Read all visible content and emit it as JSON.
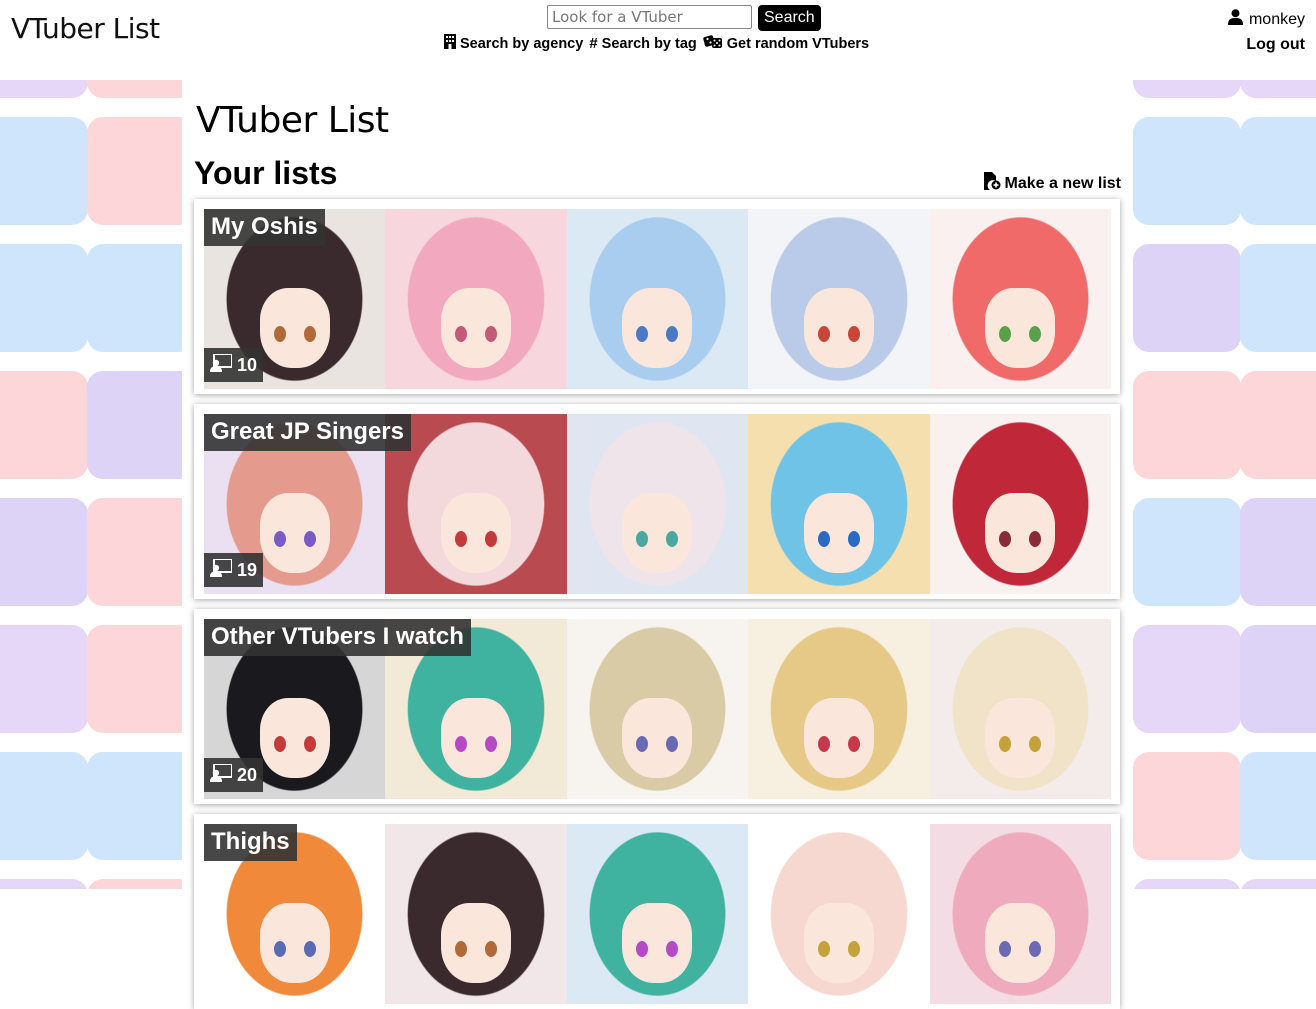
{
  "header": {
    "logo": "VTuber List",
    "search": {
      "placeholder": "Look for a VTuber",
      "button_label": "Search"
    },
    "nav": [
      {
        "icon": "building-icon",
        "label": "Search by agency"
      },
      {
        "icon": "hashtag-icon",
        "label": "Search by tag"
      },
      {
        "icon": "dice-icon",
        "label": "Get random VTubers"
      }
    ],
    "user": {
      "icon": "user-icon",
      "name": "monkey",
      "logout_label": "Log out"
    }
  },
  "main": {
    "page_title": "VTuber List",
    "section_title": "Your lists",
    "new_list_label": "Make a new list",
    "lists": [
      {
        "name": "My Oshis",
        "count": "10",
        "thumbs": [
          {
            "bg": "#e9e4df",
            "hair": "#3a2a2e",
            "eye": "#b06a3a"
          },
          {
            "bg": "#f7d6de",
            "hair": "#f2a9bf",
            "eye": "#c45a7a"
          },
          {
            "bg": "#dbe9f5",
            "hair": "#a9cdee",
            "eye": "#4a7ac4"
          },
          {
            "bg": "#f3f4f8",
            "hair": "#b9cbe9",
            "eye": "#c8453a"
          },
          {
            "bg": "#fbf0f0",
            "hair": "#f06a6a",
            "eye": "#5aa04a"
          }
        ]
      },
      {
        "name": "Great JP Singers",
        "count": "19",
        "thumbs": [
          {
            "bg": "#eae0f1",
            "hair": "#e59a8e",
            "eye": "#7a5ac4"
          },
          {
            "bg": "#b94a50",
            "hair": "#f3d8dc",
            "eye": "#c43a3a"
          },
          {
            "bg": "#dfe6f1",
            "hair": "#efe4ea",
            "eye": "#4aa8a0"
          },
          {
            "bg": "#f5dfae",
            "hair": "#6fc3e6",
            "eye": "#2a6ac4"
          },
          {
            "bg": "#f8f1f0",
            "hair": "#c0283a",
            "eye": "#8a2a3a"
          }
        ]
      },
      {
        "name": "Other VTubers I watch",
        "count": "20",
        "thumbs": [
          {
            "bg": "#d6d6d6",
            "hair": "#1a1a1e",
            "eye": "#c43a3a"
          },
          {
            "bg": "#f2ead6",
            "hair": "#3fb3a0",
            "eye": "#b44ac4"
          },
          {
            "bg": "#f7f4ef",
            "hair": "#d8cba5",
            "eye": "#6a6ab4"
          },
          {
            "bg": "#f7efe0",
            "hair": "#e6c887",
            "eye": "#c43a4a"
          },
          {
            "bg": "#f3ecea",
            "hair": "#f1e3c8",
            "eye": "#c4a23a"
          }
        ]
      },
      {
        "name": "Thighs",
        "count": "",
        "thumbs": [
          {
            "bg": "#ffffff",
            "hair": "#f08a3a",
            "eye": "#5a6ab4"
          },
          {
            "bg": "#f1e6e8",
            "hair": "#3a2a2e",
            "eye": "#b06a3a"
          },
          {
            "bg": "#dbe9f5",
            "hair": "#3fb3a0",
            "eye": "#b44ac4"
          },
          {
            "bg": "#ffffff",
            "hair": "#f6d8d0",
            "eye": "#c4a23a"
          },
          {
            "bg": "#f3dce4",
            "hair": "#f0aabe",
            "eye": "#6a6ab4"
          }
        ]
      }
    ]
  },
  "colors": {
    "tile_blue": "#cfe5fb",
    "tile_pink": "#fdd6d9",
    "tile_purple": "#ddd3f6",
    "badge_bg": "#333333"
  }
}
